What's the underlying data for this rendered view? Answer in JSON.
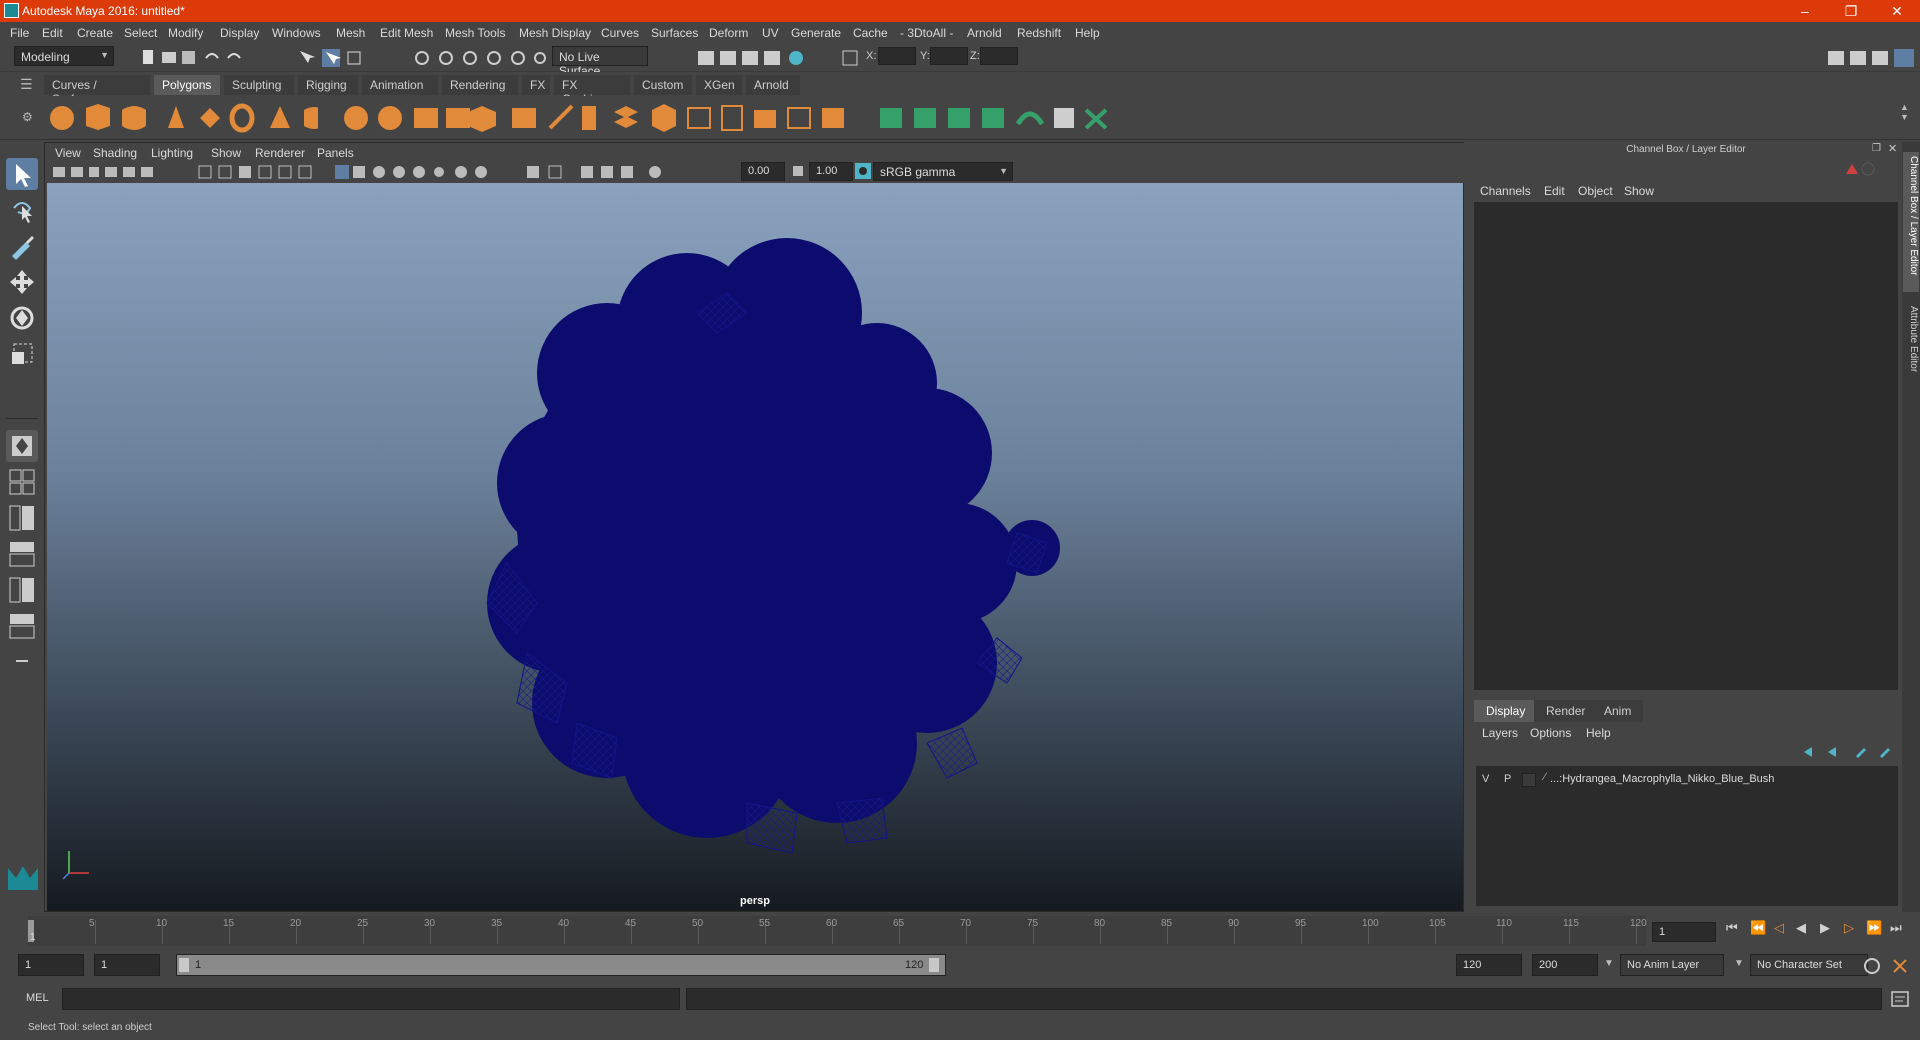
{
  "window": {
    "title": "Autodesk Maya 2016: untitled*"
  },
  "menubar": [
    "File",
    "Edit",
    "Create",
    "Select",
    "Modify",
    "Display",
    "Windows",
    "Mesh",
    "Edit Mesh",
    "Mesh Tools",
    "Mesh Display",
    "Curves",
    "Surfaces",
    "Deform",
    "UV",
    "Generate",
    "Cache",
    "- 3DtoAll -",
    "Arnold",
    "Redshift",
    "Help"
  ],
  "statusline": {
    "mode": "Modeling",
    "live_surface": "No Live Surface",
    "x_label": "X:",
    "y_label": "Y:",
    "z_label": "Z:"
  },
  "shelf_tabs": [
    "Curves / Surfaces",
    "Polygons",
    "Sculpting",
    "Rigging",
    "Animation",
    "Rendering",
    "FX",
    "FX Caching",
    "Custom",
    "XGen",
    "Arnold"
  ],
  "shelf_active": "Polygons",
  "viewport": {
    "menus": [
      "View",
      "Shading",
      "Lighting",
      "Show",
      "Renderer",
      "Panels"
    ],
    "exposure": "0.00",
    "gamma": "1.00",
    "color_space": "sRGB gamma",
    "camera": "persp"
  },
  "right_panel": {
    "title": "Channel Box / Layer Editor",
    "channel_menus": [
      "Channels",
      "Edit",
      "Object",
      "Show"
    ],
    "tabs": [
      "Display",
      "Render",
      "Anim"
    ],
    "active_tab": "Display",
    "layer_menus": [
      "Layers",
      "Options",
      "Help"
    ],
    "layer": {
      "v": "V",
      "p": "P",
      "name": "...:Hydrangea_Macrophylla_Nikko_Blue_Bush"
    }
  },
  "side_tabs": [
    "Channel Box / Layer Editor",
    "Attribute Editor"
  ],
  "timeline": {
    "ticks": [
      "5",
      "10",
      "15",
      "20",
      "25",
      "30",
      "35",
      "40",
      "45",
      "50",
      "55",
      "60",
      "65",
      "70",
      "75",
      "80",
      "85",
      "90",
      "95",
      "100",
      "105",
      "110",
      "115",
      "120"
    ],
    "start_label": "1",
    "current_frame": "1"
  },
  "range": {
    "start": "1",
    "playback_start": "1",
    "slider_start": "1",
    "slider_end": "120",
    "playback_end": "120",
    "end": "200",
    "anim_layer": "No Anim Layer",
    "character_set": "No Character Set"
  },
  "command": {
    "label": "MEL"
  },
  "help": {
    "text": "Select Tool: select an object"
  }
}
